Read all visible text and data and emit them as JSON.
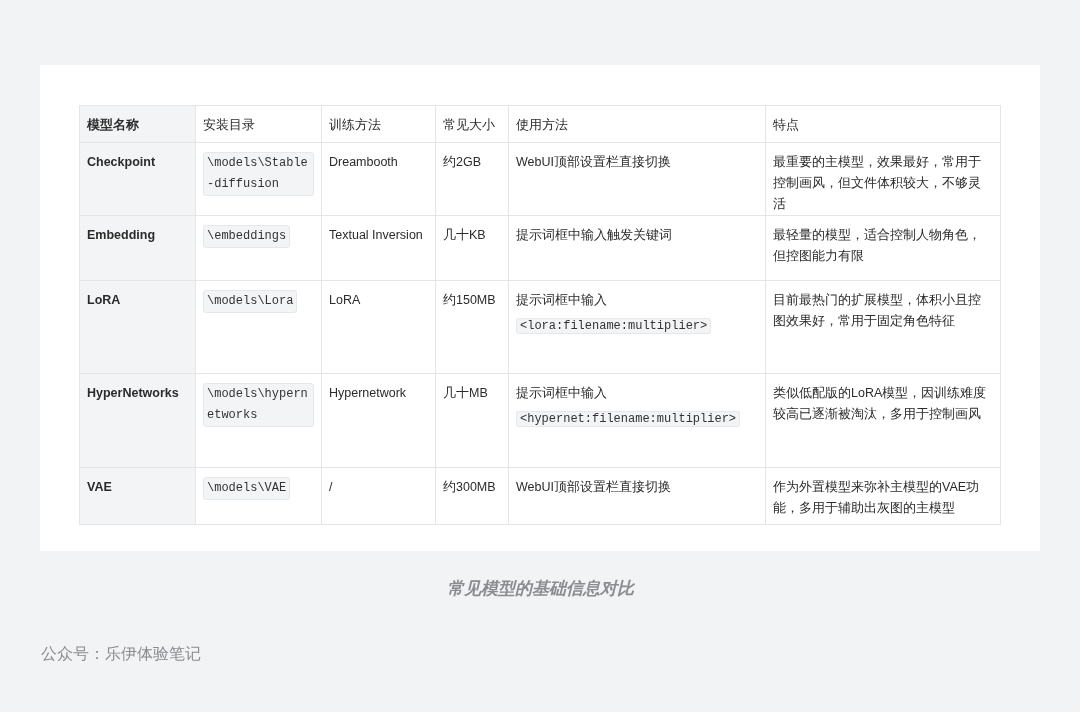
{
  "table": {
    "columns": [
      "模型名称",
      "安装目录",
      "训练方法",
      "常见大小",
      "使用方法",
      "特点"
    ],
    "rows": [
      {
        "name": "Checkpoint",
        "directory": "\\models\\Stable-diffusion",
        "training": "Dreambooth",
        "size": "约2GB",
        "usage": {
          "text": "WebUI顶部设置栏直接切换"
        },
        "features": "最重要的主模型，效果最好，常用于控制画风，但文件体积较大，不够灵活"
      },
      {
        "name": "Embedding",
        "directory": "\\embeddings",
        "training": "Textual Inversion",
        "size": "几十KB",
        "usage": {
          "text": "提示词框中输入触发关键词"
        },
        "features": "最轻量的模型，适合控制人物角色，但控图能力有限"
      },
      {
        "name": "LoRA",
        "directory": "\\models\\Lora",
        "training": "LoRA",
        "size": "约150MB",
        "usage": {
          "text": "提示词框中输入",
          "code": "<lora:filename:multiplier>"
        },
        "features": "目前最热门的扩展模型，体积小且控图效果好，常用于固定角色特征"
      },
      {
        "name": "HyperNetworks",
        "directory": "\\models\\hypernetworks",
        "training": "Hypernetwork",
        "size": "几十MB",
        "usage": {
          "text": "提示词框中输入",
          "code": "<hypernet:filename:multiplier>"
        },
        "features": "类似低配版的LoRA模型，因训练难度较高已逐渐被淘汰，多用于控制画风"
      },
      {
        "name": "VAE",
        "directory": "\\models\\VAE",
        "training": "/",
        "size": "约300MB",
        "usage": {
          "text": "WebUI顶部设置栏直接切换"
        },
        "features": "作为外置模型来弥补主模型的VAE功能，多用于辅助出灰图的主模型"
      }
    ]
  },
  "caption": "常见模型的基础信息对比",
  "credit": "公众号：乐伊体验笔记"
}
